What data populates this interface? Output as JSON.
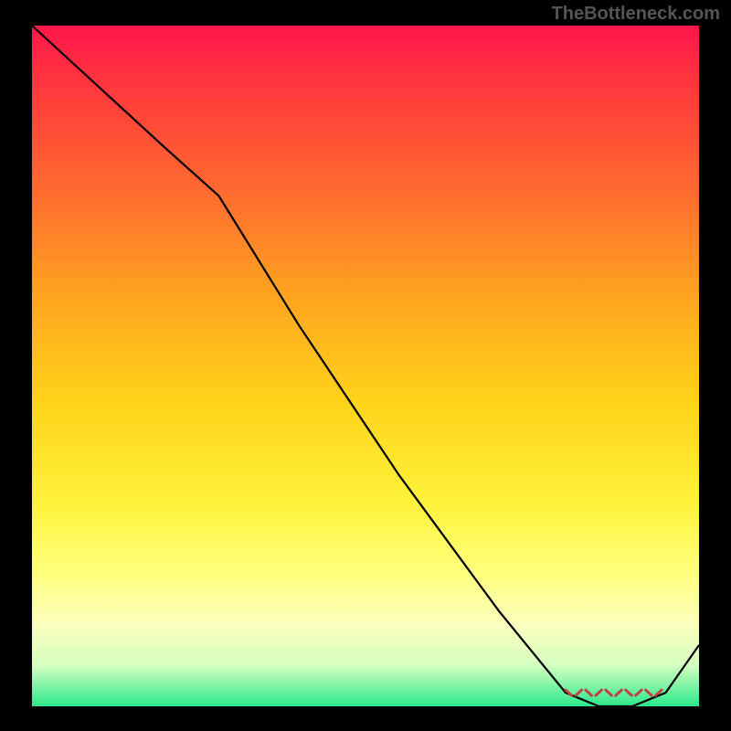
{
  "watermark": "TheBottleneck.com",
  "chart_data": {
    "type": "line",
    "title": "",
    "xlabel": "",
    "ylabel": "",
    "xlim": [
      0,
      100
    ],
    "ylim": [
      0,
      100
    ],
    "series": [
      {
        "name": "curve",
        "x": [
          0,
          10,
          20,
          28,
          40,
          55,
          70,
          80,
          85,
          90,
          95,
          100
        ],
        "y": [
          100,
          91,
          82,
          75,
          56,
          34,
          14,
          2,
          0,
          0,
          2,
          9
        ]
      }
    ],
    "annotations": [
      {
        "name": "marker-band",
        "x_start": 80,
        "x_end": 95,
        "y": 2
      }
    ],
    "gradient_stops": [
      {
        "pos": 0,
        "color": "#ff164a"
      },
      {
        "pos": 10,
        "color": "#ff3b3b"
      },
      {
        "pos": 25,
        "color": "#ff6d2f"
      },
      {
        "pos": 40,
        "color": "#ffa51f"
      },
      {
        "pos": 55,
        "color": "#ffd21a"
      },
      {
        "pos": 70,
        "color": "#fff23a"
      },
      {
        "pos": 80,
        "color": "#ffff7a"
      },
      {
        "pos": 88,
        "color": "#fcffbe"
      },
      {
        "pos": 94,
        "color": "#d4ffc0"
      },
      {
        "pos": 100,
        "color": "#2be88b"
      }
    ]
  }
}
